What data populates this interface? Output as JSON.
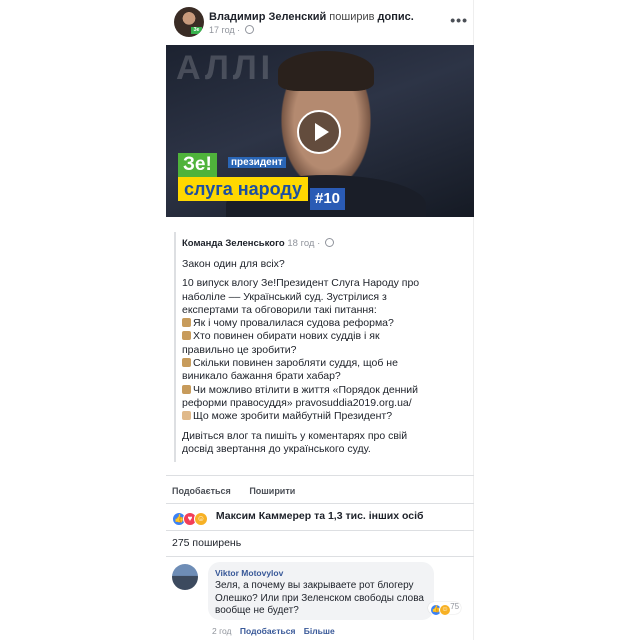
{
  "post": {
    "author": "Владимир Зеленский",
    "action": "поширив",
    "object": "допис.",
    "time": "17 год",
    "more_icon": "more-dots-icon",
    "privacy_icon": "globe-icon"
  },
  "video": {
    "badge_ze": "Зе!",
    "badge_president": "президент",
    "badge_party": "слуга народу",
    "episode": "#10",
    "bg_text": "АЛЛІ"
  },
  "shared": {
    "author": "Команда Зеленського",
    "time": "18 год",
    "line1": "Закон один для всіх?",
    "body": [
      "10 випуск влогу Зе!Президент Слуга Народу про",
      "наболіле –– Український суд. Зустрілися з",
      "експертами та обговорили такі питання:",
      "Як і чому провалилася судова реформа?",
      "Хто повинен обирати нових суддів і як",
      "правильно це зробити?",
      "Скільки повинен заробляти суддя, щоб не",
      "виникало бажання брати хабар?",
      "Чи можливо втілити в життя «Порядок денний",
      "реформи правосуддя» pravosuddia2019.org.ua/",
      "Що може зробити майбутній Президент?"
    ],
    "closing": [
      "Дивіться влог та пишіть у коментарях про свій",
      "досвід звертання до українського суду."
    ]
  },
  "actions": {
    "like": "Подобається",
    "share": "Поширити"
  },
  "reactions": {
    "summary": "Максим Каммерер та 1,3 тис. інших осіб"
  },
  "shares": "275 поширень",
  "comment": {
    "author": "Viktor Motovylov",
    "text": "Зеля, а почему вы закрываете рот блогеру Олешко? Или при Зеленском свободы слова вообще не будет?",
    "reaction_count": "75",
    "time": "2 год",
    "like": "Подобається",
    "more": "Більше"
  }
}
